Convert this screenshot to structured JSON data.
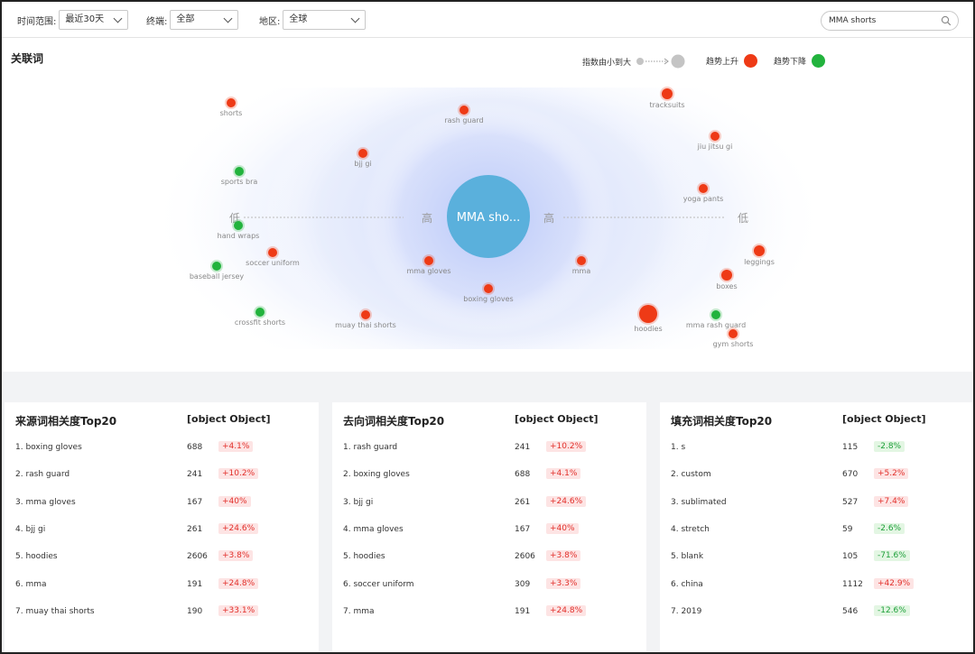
{
  "filters": {
    "time": {
      "label": "时间范围:",
      "value": "最近30天"
    },
    "terminal": {
      "label": "终端:",
      "value": "全部"
    },
    "region": {
      "label": "地区:",
      "value": "全球"
    }
  },
  "search": {
    "value": "MMA shorts"
  },
  "related": {
    "title": "关联词",
    "legend": {
      "size_label": "指数由小到大",
      "up_label": "趋势上升",
      "down_label": "趋势下降"
    },
    "center_label": "MMA sho...",
    "axis": {
      "low": "低",
      "high": "高"
    },
    "colors": {
      "up": "#ee3a16",
      "down": "#22b33d",
      "size_dot": "#c4c4c4",
      "center": "#5ab0dc"
    },
    "words": [
      {
        "text": "shorts",
        "trend": "up"
      },
      {
        "text": "rash guard",
        "trend": "up"
      },
      {
        "text": "tracksuits",
        "trend": "up"
      },
      {
        "text": "jiu jitsu gi",
        "trend": "up"
      },
      {
        "text": "bjj gi",
        "trend": "up"
      },
      {
        "text": "sports bra",
        "trend": "down"
      },
      {
        "text": "yoga pants",
        "trend": "up"
      },
      {
        "text": "hand wraps",
        "trend": "down"
      },
      {
        "text": "soccer uniform",
        "trend": "up"
      },
      {
        "text": "baseball jersey",
        "trend": "down"
      },
      {
        "text": "mma gloves",
        "trend": "up"
      },
      {
        "text": "mma",
        "trend": "up"
      },
      {
        "text": "leggings",
        "trend": "up"
      },
      {
        "text": "boxes",
        "trend": "up"
      },
      {
        "text": "boxing gloves",
        "trend": "up"
      },
      {
        "text": "crossfit shorts",
        "trend": "down"
      },
      {
        "text": "muay thai shorts",
        "trend": "up"
      },
      {
        "text": "hoodies",
        "trend": "up"
      },
      {
        "text": "mma rash guard",
        "trend": "down"
      },
      {
        "text": "gym shorts",
        "trend": "up"
      }
    ]
  },
  "tables": [
    {
      "title": "来源词相关度Top20",
      "column": "[object Object]",
      "rows": [
        {
          "keyword": "1. boxing gloves",
          "value": "688",
          "change": "+4.1%",
          "trend": "up"
        },
        {
          "keyword": "2. rash guard",
          "value": "241",
          "change": "+10.2%",
          "trend": "up"
        },
        {
          "keyword": "3. mma gloves",
          "value": "167",
          "change": "+40%",
          "trend": "up"
        },
        {
          "keyword": "4. bjj gi",
          "value": "261",
          "change": "+24.6%",
          "trend": "up"
        },
        {
          "keyword": "5. hoodies",
          "value": "2606",
          "change": "+3.8%",
          "trend": "up"
        },
        {
          "keyword": "6. mma",
          "value": "191",
          "change": "+24.8%",
          "trend": "up"
        },
        {
          "keyword": "7. muay thai shorts",
          "value": "190",
          "change": "+33.1%",
          "trend": "up"
        }
      ]
    },
    {
      "title": "去向词相关度Top20",
      "column": "[object Object]",
      "rows": [
        {
          "keyword": "1. rash guard",
          "value": "241",
          "change": "+10.2%",
          "trend": "up"
        },
        {
          "keyword": "2. boxing gloves",
          "value": "688",
          "change": "+4.1%",
          "trend": "up"
        },
        {
          "keyword": "3. bjj gi",
          "value": "261",
          "change": "+24.6%",
          "trend": "up"
        },
        {
          "keyword": "4. mma gloves",
          "value": "167",
          "change": "+40%",
          "trend": "up"
        },
        {
          "keyword": "5. hoodies",
          "value": "2606",
          "change": "+3.8%",
          "trend": "up"
        },
        {
          "keyword": "6. soccer uniform",
          "value": "309",
          "change": "+3.3%",
          "trend": "up"
        },
        {
          "keyword": "7. mma",
          "value": "191",
          "change": "+24.8%",
          "trend": "up"
        }
      ]
    },
    {
      "title": "填充词相关度Top20",
      "column": "[object Object]",
      "rows": [
        {
          "keyword": "1. s",
          "value": "115",
          "change": "-2.8%",
          "trend": "down"
        },
        {
          "keyword": "2. custom",
          "value": "670",
          "change": "+5.2%",
          "trend": "up"
        },
        {
          "keyword": "3. sublimated",
          "value": "527",
          "change": "+7.4%",
          "trend": "up"
        },
        {
          "keyword": "4. stretch",
          "value": "59",
          "change": "-2.6%",
          "trend": "down"
        },
        {
          "keyword": "5. blank",
          "value": "105",
          "change": "-71.6%",
          "trend": "down"
        },
        {
          "keyword": "6. china",
          "value": "1112",
          "change": "+42.9%",
          "trend": "up"
        },
        {
          "keyword": "7. 2019",
          "value": "546",
          "change": "-12.6%",
          "trend": "down"
        }
      ]
    }
  ]
}
